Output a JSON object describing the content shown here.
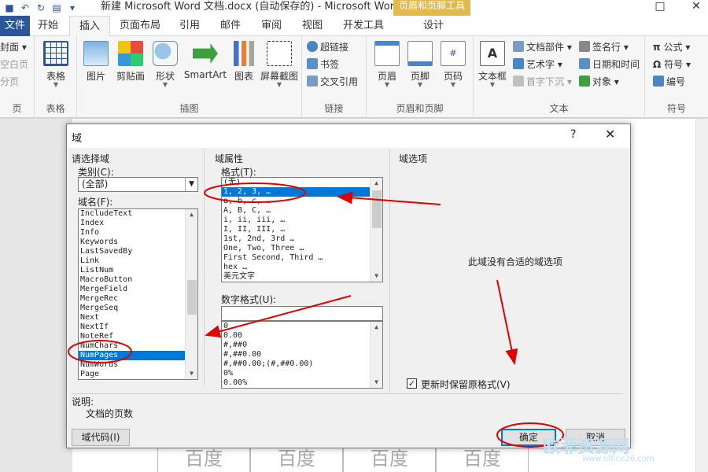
{
  "window": {
    "title": "新建 Microsoft Word 文档.docx (自动保存的)  -  Microsoft Word",
    "context_tab": "页眉和页脚工具",
    "qat_icons": [
      "save-icon",
      "undo-icon",
      "redo-icon",
      "print-icon",
      "customize-icon"
    ]
  },
  "tabs": {
    "file": "文件",
    "items": [
      "开始",
      "插入",
      "页面布局",
      "引用",
      "邮件",
      "审阅",
      "视图",
      "开发工具",
      "设计"
    ],
    "active": "插入"
  },
  "ribbon": {
    "pages_group": {
      "label": "页",
      "items": [
        "封面",
        "空白页",
        "分页"
      ]
    },
    "table_group": {
      "label": "表格",
      "button": "表格"
    },
    "illustrations_group": {
      "label": "插图",
      "buttons": [
        "图片",
        "剪贴画",
        "形状",
        "SmartArt",
        "图表",
        "屏幕截图"
      ]
    },
    "links_group": {
      "label": "链接",
      "buttons": [
        "超链接",
        "书签",
        "交叉引用"
      ]
    },
    "header_footer_group": {
      "label": "页眉和页脚",
      "buttons": [
        "页眉",
        "页脚",
        "页码"
      ]
    },
    "text_group": {
      "label": "文本",
      "big": "文本框",
      "buttons": [
        "文档部件",
        "艺术字",
        "首字下沉",
        "签名行",
        "日期和时间",
        "对象"
      ]
    },
    "symbols_group": {
      "label": "符号",
      "buttons": [
        "公式",
        "符号",
        "编号"
      ]
    }
  },
  "document": {
    "footer_cells": [
      "百度",
      "百度",
      "百度",
      "百度"
    ]
  },
  "dialog": {
    "title": "域",
    "help": "?",
    "close": "✕",
    "choose_field": "请选择域",
    "category_label": "类别(C):",
    "category_value": "(全部)",
    "fieldname_label": "域名(F):",
    "field_names": [
      "IncludeText",
      "Index",
      "Info",
      "Keywords",
      "LastSavedBy",
      "Link",
      "ListNum",
      "MacroButton",
      "MergeField",
      "MergeRec",
      "MergeSeq",
      "Next",
      "NextIf",
      "NoteRef",
      "NumChars",
      "NumPages",
      "NumWords",
      "Page"
    ],
    "field_selected": "NumPages",
    "field_props": "域属性",
    "format_label": "格式(T):",
    "formats": [
      "(无)",
      "1, 2, 3, …",
      "a, b, c, …",
      "A, B, C, …",
      "i, ii, iii, …",
      "I, II, III, …",
      "1st, 2nd, 3rd …",
      "One, Two, Three …",
      "First Second, Third …",
      "hex …",
      "美元文字"
    ],
    "format_selected": "1, 2, 3, …",
    "numformat_label": "数字格式(U):",
    "numformat_value": "",
    "numformats": [
      "0",
      "0.00",
      "#,##0",
      "#,##0.00",
      "#,##0.00;(#,##0.00)",
      "0%",
      "0.00%"
    ],
    "field_options": "域选项",
    "no_options": "此域没有合适的域选项",
    "preserve_format": "更新时保留原格式(V)",
    "preserve_checked": true,
    "description_label": "说明:",
    "description": "文档的页数",
    "field_codes_button": "域代码(I)",
    "ok_button": "确定",
    "cancel_button": "取消"
  },
  "watermark": {
    "text": "欧菲资源网",
    "url": "www.office26.com"
  },
  "colors": {
    "accent": "#2b579a",
    "selection": "#0078d7",
    "annotation": "#e00000",
    "context_tab": "#e2b94e"
  }
}
